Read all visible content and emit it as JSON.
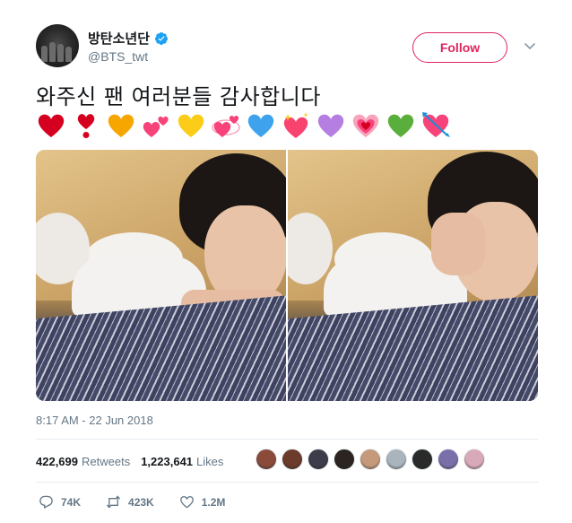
{
  "user": {
    "display_name": "방탄소년단",
    "handle": "@BTS_twt",
    "verified_icon": "verified-badge-icon"
  },
  "follow_button": {
    "label": "Follow"
  },
  "tweet": {
    "text": "와주신 팬 여러분들 감사합니다",
    "emojis": [
      "red-heart",
      "heavy-exclamation-heart",
      "yellow-heart",
      "two-hearts",
      "yellow-heart",
      "revolving-hearts",
      "blue-heart",
      "sparkling-heart",
      "purple-heart",
      "growing-heart",
      "green-heart",
      "heart-with-arrow"
    ],
    "timestamp": "8:17 AM - 22 Jun 2018"
  },
  "stats": {
    "retweets_count": "422,699",
    "retweets_label": "Retweets",
    "likes_count": "1,223,641",
    "likes_label": "Likes"
  },
  "likers": [
    "#8a4b3a",
    "#6b3b2b",
    "#3c3c4a",
    "#2b2420",
    "#c49a7a",
    "#aab4bd",
    "#2a2a2a",
    "#7a6fa8",
    "#d8a9b8"
  ],
  "actions": {
    "reply_count": "74K",
    "retweet_count": "423K",
    "like_count": "1.2M"
  },
  "colors": {
    "accent_pink": "#e0245e",
    "verified_blue": "#1da1f2",
    "muted": "#657786"
  }
}
